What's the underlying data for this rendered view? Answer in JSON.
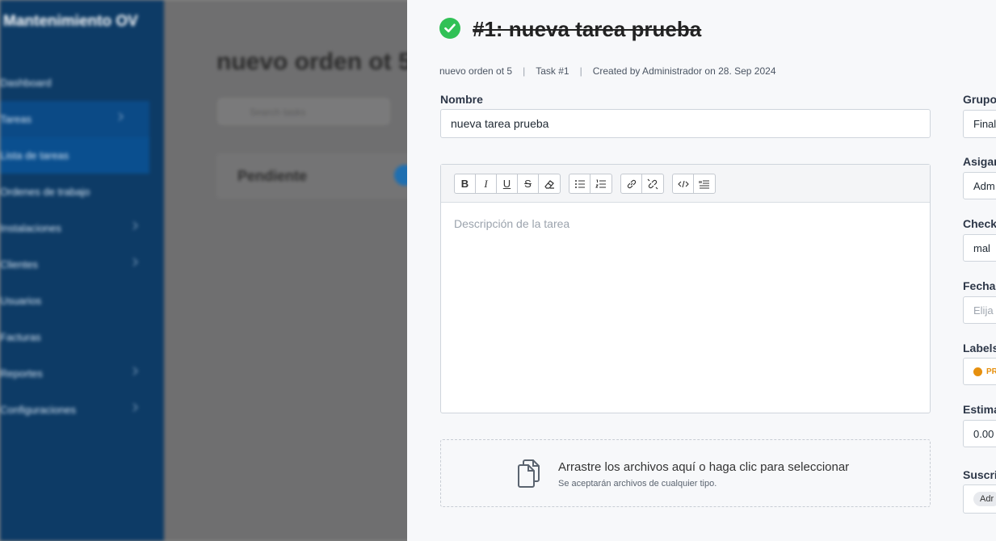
{
  "background": {
    "brand": "Mantenimiento OV",
    "page_title": "nuevo orden ot 5",
    "search_placeholder": "Search tasks",
    "column_title": "Pendiente",
    "nav": [
      {
        "label": "Dashboard"
      },
      {
        "label": "Tareas"
      },
      {
        "label": "Lista de tareas"
      },
      {
        "label": "Ordenes de trabajo"
      },
      {
        "label": "Instalaciones"
      },
      {
        "label": "Clientes"
      },
      {
        "label": "Usuarios"
      },
      {
        "label": "Facturas"
      },
      {
        "label": "Reportes"
      },
      {
        "label": "Configuraciones"
      }
    ]
  },
  "task": {
    "title": "#1: nueva tarea prueba",
    "meta": {
      "project": "nuevo orden ot 5",
      "task_ref": "Task #1",
      "created": "Created by Administrador on 28. Sep 2024"
    },
    "name_label": "Nombre",
    "name_value": "nueva tarea prueba",
    "description_placeholder": "Descripción de la tarea",
    "toolbar": {
      "bold": "B",
      "italic": "I",
      "underline": "U",
      "strike": "S"
    },
    "dropzone": {
      "main": "Arrastre los archivos aquí o haga clic para seleccionar",
      "sub": "Se aceptarán archivos de cualquier tipo."
    }
  },
  "side": {
    "grupo_label": "Grupo",
    "grupo_value": "Final",
    "asignado_label": "Asigan",
    "asignado_value": "Adm",
    "check_label": "Check",
    "check_value": "mal",
    "fecha_label": "Fecha d",
    "fecha_placeholder": "Elija",
    "labels_label": "Labels",
    "labels_value": "PR",
    "estimate_label": "Estima",
    "estimate_value": "0.00",
    "subs_label": "Suscrip",
    "subs_value": "Adr"
  }
}
